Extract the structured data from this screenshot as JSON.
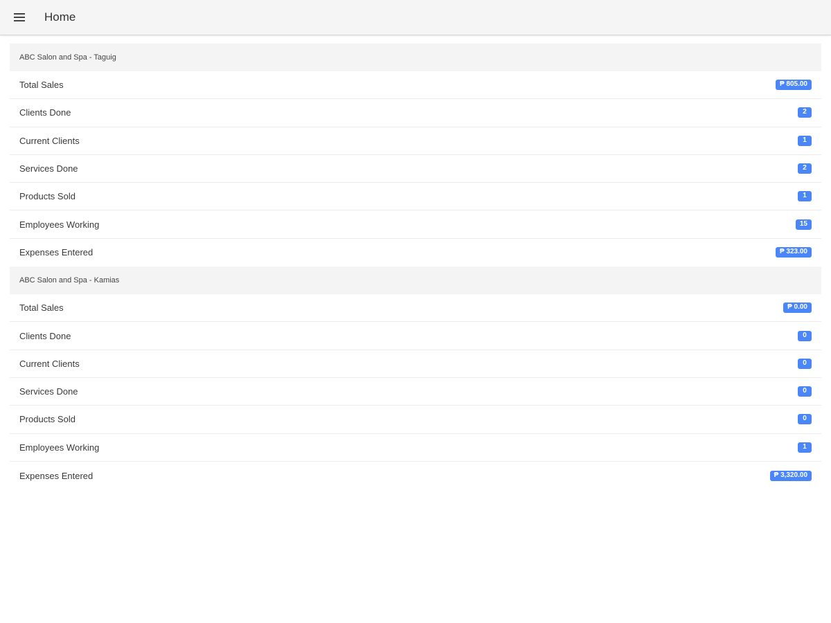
{
  "header": {
    "title": "Home",
    "menu_icon": "menu-icon"
  },
  "colors": {
    "badge": "#4a86f7",
    "header_bg": "#f5f5f5",
    "section_bg": "#f4f4f4"
  },
  "branches": [
    {
      "name": "ABC Salon and Spa - Taguig",
      "stats": [
        {
          "label": "Total Sales",
          "value": "₱ 805.00"
        },
        {
          "label": "Clients Done",
          "value": "2"
        },
        {
          "label": "Current Clients",
          "value": "1"
        },
        {
          "label": "Services Done",
          "value": "2"
        },
        {
          "label": "Products Sold",
          "value": "1"
        },
        {
          "label": "Employees Working",
          "value": "15"
        },
        {
          "label": "Expenses Entered",
          "value": "₱ 323.00"
        }
      ]
    },
    {
      "name": "ABC Salon and Spa - Kamias",
      "stats": [
        {
          "label": "Total Sales",
          "value": "₱ 0.00"
        },
        {
          "label": "Clients Done",
          "value": "0"
        },
        {
          "label": "Current Clients",
          "value": "0"
        },
        {
          "label": "Services Done",
          "value": "0"
        },
        {
          "label": "Products Sold",
          "value": "0"
        },
        {
          "label": "Employees Working",
          "value": "1"
        },
        {
          "label": "Expenses Entered",
          "value": "₱ 3,320.00"
        }
      ]
    }
  ]
}
